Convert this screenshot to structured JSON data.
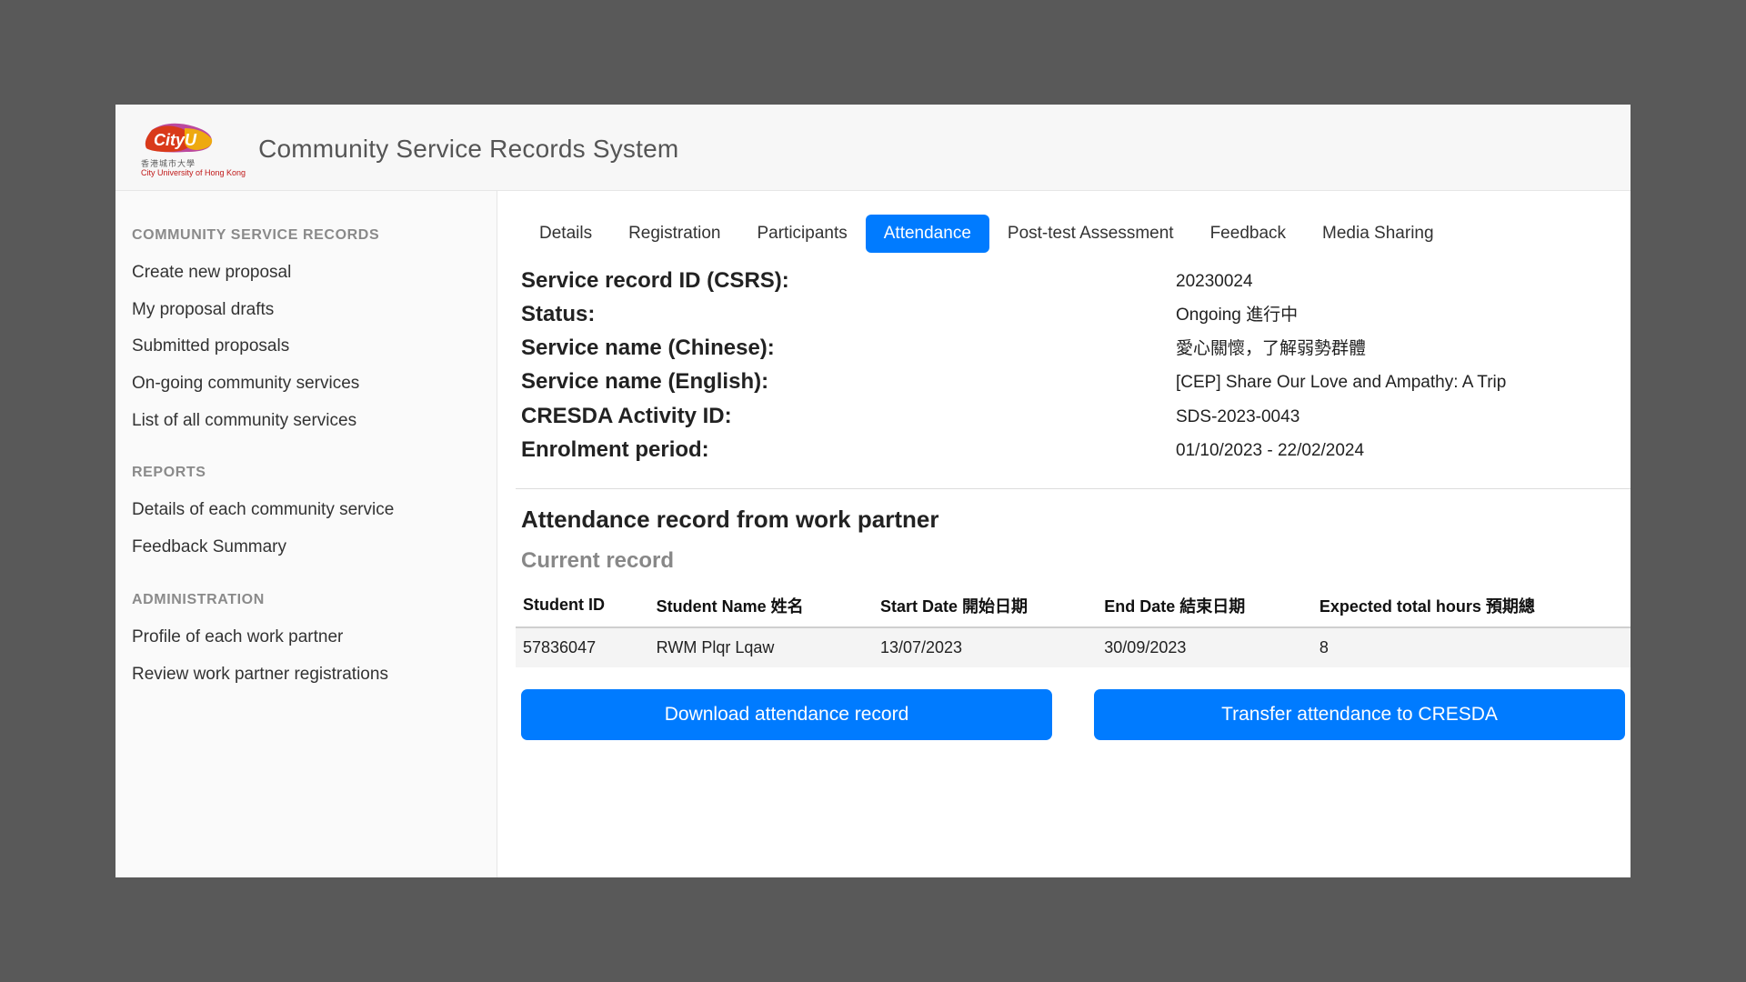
{
  "header": {
    "title": "Community Service Records System",
    "logo_text": "CityU",
    "logo_sub1": "香港城市大學",
    "logo_sub2": "City University of Hong Kong"
  },
  "sidebar": {
    "sections": [
      {
        "heading": "COMMUNITY SERVICE RECORDS",
        "items": [
          "Create new proposal",
          "My proposal drafts",
          "Submitted proposals",
          "On-going community services",
          "List of all community services"
        ]
      },
      {
        "heading": "REPORTS",
        "items": [
          "Details of each community service",
          "Feedback Summary"
        ]
      },
      {
        "heading": "ADMINISTRATION",
        "items": [
          "Profile of each work partner",
          "Review work partner registrations"
        ]
      }
    ]
  },
  "tabs": [
    "Details",
    "Registration",
    "Participants",
    "Attendance",
    "Post-test Assessment",
    "Feedback",
    "Media Sharing"
  ],
  "active_tab_index": 3,
  "details": {
    "labels": {
      "id": "Service record ID (CSRS):",
      "status": "Status:",
      "name_cn": "Service name (Chinese):",
      "name_en": "Service name (English):",
      "cresda": "CRESDA Activity ID:",
      "enrol": "Enrolment period:"
    },
    "values": {
      "id": "20230024",
      "status": "Ongoing 進行中",
      "name_cn": "愛心關懷，了解弱勢群體",
      "name_en": "[CEP] Share Our Love and Ampathy: A Trip",
      "cresda": "SDS-2023-0043",
      "enrol": "01/10/2023 - 22/02/2024"
    }
  },
  "attendance": {
    "section_heading": "Attendance record from work partner",
    "subsection_heading": "Current record",
    "columns": {
      "sid": "Student ID",
      "sname": "Student Name 姓名",
      "start": "Start Date 開始日期",
      "end": "End Date 結束日期",
      "hours": "Expected total hours 預期總"
    },
    "rows": [
      {
        "sid": "57836047",
        "sname": "RWM Plqr Lqaw",
        "start": "13/07/2023",
        "end": "30/09/2023",
        "hours": "8"
      }
    ]
  },
  "buttons": {
    "download": "Download attendance record",
    "transfer": "Transfer attendance to CRESDA"
  }
}
